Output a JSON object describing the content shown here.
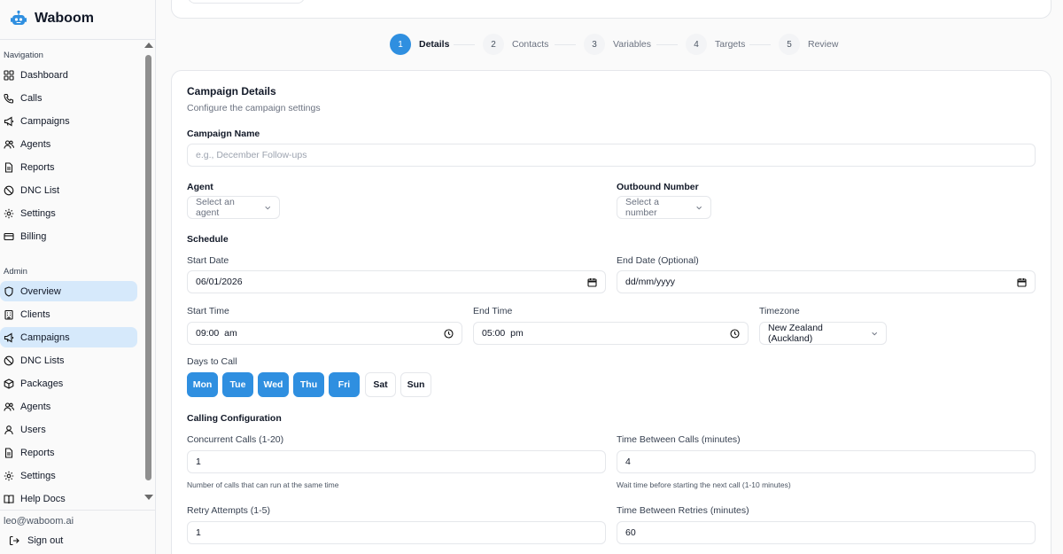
{
  "brand": {
    "name": "Waboom"
  },
  "sidebar": {
    "navigation_label": "Navigation",
    "navigation": [
      {
        "label": "Dashboard",
        "icon": "grid-icon"
      },
      {
        "label": "Calls",
        "icon": "phone-icon"
      },
      {
        "label": "Campaigns",
        "icon": "megaphone-icon"
      },
      {
        "label": "Agents",
        "icon": "users-icon"
      },
      {
        "label": "Reports",
        "icon": "file-icon"
      },
      {
        "label": "DNC List",
        "icon": "ban-icon"
      },
      {
        "label": "Settings",
        "icon": "gear-icon"
      },
      {
        "label": "Billing",
        "icon": "credit-card-icon"
      }
    ],
    "admin_label": "Admin",
    "admin": [
      {
        "label": "Overview",
        "icon": "shield-icon",
        "active": true
      },
      {
        "label": "Clients",
        "icon": "building-icon"
      },
      {
        "label": "Campaigns",
        "icon": "megaphone-icon",
        "active": true
      },
      {
        "label": "DNC Lists",
        "icon": "ban-icon"
      },
      {
        "label": "Packages",
        "icon": "package-icon"
      },
      {
        "label": "Agents",
        "icon": "users-icon"
      },
      {
        "label": "Users",
        "icon": "user-icon"
      },
      {
        "label": "Reports",
        "icon": "file-icon"
      },
      {
        "label": "Settings",
        "icon": "gear-icon"
      },
      {
        "label": "Help Docs",
        "icon": "book-icon"
      }
    ],
    "user_email": "leo@waboom.ai",
    "sign_out": "Sign out"
  },
  "stepper": {
    "steps": [
      {
        "num": "1",
        "label": "Details",
        "active": true
      },
      {
        "num": "2",
        "label": "Contacts"
      },
      {
        "num": "3",
        "label": "Variables"
      },
      {
        "num": "4",
        "label": "Targets"
      },
      {
        "num": "5",
        "label": "Review"
      }
    ]
  },
  "form": {
    "title": "Campaign Details",
    "subtitle": "Configure the campaign settings",
    "campaign_name": {
      "label": "Campaign Name",
      "placeholder": "e.g., December Follow-ups",
      "value": ""
    },
    "agent": {
      "label": "Agent",
      "placeholder": "Select an agent"
    },
    "outbound": {
      "label": "Outbound Number",
      "placeholder": "Select a number"
    },
    "schedule": {
      "heading": "Schedule",
      "start_date": {
        "label": "Start Date",
        "value": "06/01/2026"
      },
      "end_date": {
        "label": "End Date (Optional)",
        "value": "dd/mm/yyyy"
      },
      "start_time": {
        "label": "Start Time",
        "value": "09:00  am"
      },
      "end_time": {
        "label": "End Time",
        "value": "05:00  pm"
      },
      "timezone": {
        "label": "Timezone",
        "value": "New Zealand (Auckland)"
      }
    },
    "days": {
      "label": "Days to Call",
      "items": [
        {
          "label": "Mon",
          "selected": true
        },
        {
          "label": "Tue",
          "selected": true
        },
        {
          "label": "Wed",
          "selected": true
        },
        {
          "label": "Thu",
          "selected": true
        },
        {
          "label": "Fri",
          "selected": true
        },
        {
          "label": "Sat",
          "selected": false
        },
        {
          "label": "Sun",
          "selected": false
        }
      ]
    },
    "calling": {
      "heading": "Calling Configuration",
      "concurrent": {
        "label": "Concurrent Calls (1-20)",
        "value": "1",
        "help": "Number of calls that can run at the same time"
      },
      "between_calls": {
        "label": "Time Between Calls (minutes)",
        "value": "4",
        "help": "Wait time before starting the next call (1-10 minutes)"
      },
      "retry": {
        "label": "Retry Attempts (1-5)",
        "value": "1"
      },
      "between_retries": {
        "label": "Time Between Retries (minutes)",
        "value": "60"
      }
    }
  },
  "colors": {
    "accent": "#2f8fe0",
    "active_nav": "#d6e9fb"
  }
}
